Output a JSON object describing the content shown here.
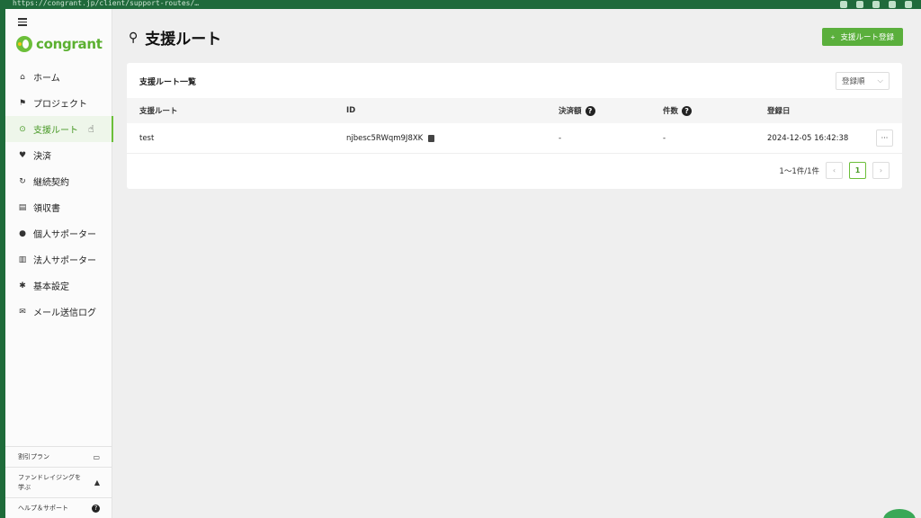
{
  "browser": {
    "url": "https://congrant.jp/client/support-routes/…"
  },
  "sidebar": {
    "logo_text": "congrant",
    "items": [
      {
        "label": "ホーム",
        "icon": "home-icon",
        "glyph": "⌂"
      },
      {
        "label": "プロジェクト",
        "icon": "flag-icon",
        "glyph": "⚑"
      },
      {
        "label": "支援ルート",
        "icon": "location-pin-icon",
        "glyph": "⊙",
        "active": true
      },
      {
        "label": "決済",
        "icon": "heart-icon",
        "glyph": "♥"
      },
      {
        "label": "継続契約",
        "icon": "refresh-icon",
        "glyph": "↻"
      },
      {
        "label": "領収書",
        "icon": "receipt-icon",
        "glyph": "▤"
      },
      {
        "label": "個人サポーター",
        "icon": "person-icon",
        "glyph": "●"
      },
      {
        "label": "法人サポーター",
        "icon": "building-icon",
        "glyph": "▥"
      },
      {
        "label": "基本設定",
        "icon": "gear-icon",
        "glyph": "✱"
      },
      {
        "label": "メール送信ログ",
        "icon": "mail-icon",
        "glyph": "✉"
      }
    ],
    "bottom": [
      {
        "label": "割引プラン",
        "icon": "gift-icon",
        "glyph": "▭"
      },
      {
        "label": "ファンドレイジングを学ぶ",
        "icon": "graduation-cap-icon",
        "glyph": "▲"
      },
      {
        "label": "ヘルプ＆サポート",
        "icon": "help-icon",
        "glyph": "?"
      }
    ]
  },
  "header": {
    "title": "支援ルート",
    "primary_button": "支援ルート登録",
    "primary_button_icon": "+"
  },
  "card": {
    "title": "支援ルート一覧",
    "sort_select": "登録順",
    "columns": [
      "支援ルート",
      "ID",
      "決済額",
      "件数",
      "登録日"
    ],
    "rows": [
      {
        "name": "test",
        "id": "njbesc5RWqm9J8XK",
        "amount": "-",
        "count": "-",
        "date": "2024-12-05 16:42:38",
        "more": "···"
      }
    ],
    "pagination": {
      "summary": "1〜1件/1件",
      "prev": "‹",
      "current": "1",
      "next": "›"
    }
  },
  "colors": {
    "accent": "#5aaf3c",
    "brand_green": "#1f6a3b"
  }
}
